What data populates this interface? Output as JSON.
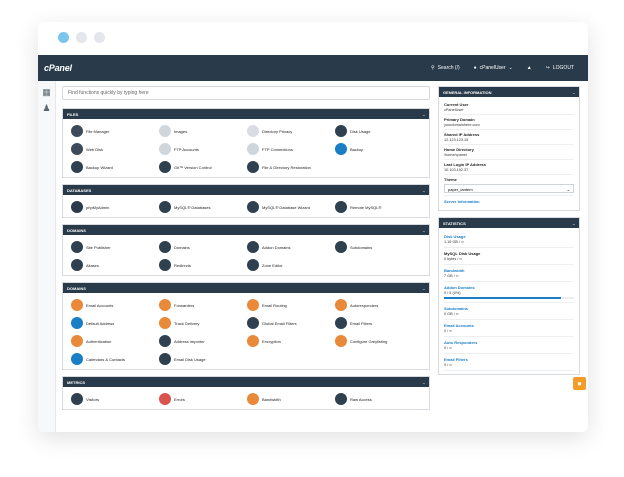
{
  "topbar": {
    "logo": "cPanel",
    "search": "Search (/)",
    "user": "cPanelUser",
    "logout": "LOGOUT"
  },
  "search": {
    "placeholder": "Find functions quickly by typing here"
  },
  "panels": [
    {
      "title": "FILES",
      "items": [
        {
          "label": "File Manager",
          "icon": "folder-icon",
          "color": "#3b4b5a"
        },
        {
          "label": "Images",
          "icon": "images-icon",
          "color": "#cfd6dc"
        },
        {
          "label": "Directory Privacy",
          "icon": "folder-lock-icon",
          "color": "#d9dde1"
        },
        {
          "label": "Disk Usage",
          "icon": "disk-icon",
          "color": "#2f4050"
        },
        {
          "label": "Web Disk",
          "icon": "webdisk-icon",
          "color": "#3b4b5a"
        },
        {
          "label": "FTP Accounts",
          "icon": "ftp-icon",
          "color": "#cfd6dc"
        },
        {
          "label": "FTP Connections",
          "icon": "truck-icon",
          "color": "#cfd6dc"
        },
        {
          "label": "Backup",
          "icon": "backup-icon",
          "color": "#1a7ec6"
        },
        {
          "label": "Backup Wizard",
          "icon": "wizard-icon",
          "color": "#2f4050"
        },
        {
          "label": "Git™ Version Control",
          "icon": "git-icon",
          "color": "#2f4050"
        },
        {
          "label": "File & Directory Restoration",
          "icon": "restore-icon",
          "color": "#2f4050"
        }
      ]
    },
    {
      "title": "DATABASES",
      "items": [
        {
          "label": "phpMyAdmin",
          "icon": "phpmyadmin-icon",
          "color": "#2a3a4a"
        },
        {
          "label": "MySQL® Databases",
          "icon": "mysql-icon",
          "color": "#2f4050"
        },
        {
          "label": "MySQL® Database Wizard",
          "icon": "mysql-wizard-icon",
          "color": "#2f4050"
        },
        {
          "label": "Remote MySQL®",
          "icon": "remote-mysql-icon",
          "color": "#2f4050"
        }
      ]
    },
    {
      "title": "DOMAINS",
      "items": [
        {
          "label": "Site Publisher",
          "icon": "publisher-icon",
          "color": "#2f4050"
        },
        {
          "label": "Domains",
          "icon": "domains-icon",
          "color": "#2f4050"
        },
        {
          "label": "Addon Domains",
          "icon": "addon-icon",
          "color": "#2f4050"
        },
        {
          "label": "Subdomains",
          "icon": "subdomain-icon",
          "color": "#2f4050"
        },
        {
          "label": "Aliases",
          "icon": "aliases-icon",
          "color": "#2f4050"
        },
        {
          "label": "Redirects",
          "icon": "redirect-icon",
          "color": "#2f4050"
        },
        {
          "label": "Zone Editor",
          "icon": "dns-icon",
          "color": "#2f4050"
        }
      ]
    },
    {
      "title": "DOMAINS",
      "items": [
        {
          "label": "Email Accounts",
          "icon": "email-icon",
          "color": "#e88a3a"
        },
        {
          "label": "Forwarders",
          "icon": "forward-icon",
          "color": "#e88a3a"
        },
        {
          "label": "Email Routing",
          "icon": "routing-icon",
          "color": "#e88a3a"
        },
        {
          "label": "Autoresponders",
          "icon": "autoresponder-icon",
          "color": "#e88a3a"
        },
        {
          "label": "Default Address",
          "icon": "default-address-icon",
          "color": "#1a7ec6"
        },
        {
          "label": "Track Delivery",
          "icon": "track-icon",
          "color": "#e88a3a"
        },
        {
          "label": "Global Email Filters",
          "icon": "filter-icon",
          "color": "#2f4050"
        },
        {
          "label": "Email Filters",
          "icon": "filter-icon",
          "color": "#2f4050"
        },
        {
          "label": "Authentication",
          "icon": "key-icon",
          "color": "#e88a3a"
        },
        {
          "label": "Address Importer",
          "icon": "import-icon",
          "color": "#2f4050"
        },
        {
          "label": "Encryption",
          "icon": "lock-icon",
          "color": "#e88a3a"
        },
        {
          "label": "Configure Greylisting",
          "icon": "greylisting-icon",
          "color": "#e88a3a"
        },
        {
          "label": "Calendars & Contacts",
          "icon": "calendar-icon",
          "color": "#1a7ec6"
        },
        {
          "label": "Email Disk Usage",
          "icon": "disk-icon",
          "color": "#2f4050"
        }
      ]
    },
    {
      "title": "METRICS",
      "items": [
        {
          "label": "Visitors",
          "icon": "visitors-icon",
          "color": "#2f4050"
        },
        {
          "label": "Errors",
          "icon": "errors-icon",
          "color": "#d9534f"
        },
        {
          "label": "Bandwidth",
          "icon": "bandwidth-icon",
          "color": "#e88a3a"
        },
        {
          "label": "Raw Access",
          "icon": "raw-icon",
          "color": "#2f4050"
        }
      ]
    }
  ],
  "general": {
    "title": "GENERAL INFORMATION",
    "rows": [
      {
        "k": "Current User",
        "v": "cPanelUser"
      },
      {
        "k": "Primary Domain",
        "v": "yourdomainhere.com"
      },
      {
        "k": "Shared IP Address",
        "v": "12.123.123.15"
      },
      {
        "k": "Home Directory",
        "v": "/home/cpanel"
      },
      {
        "k": "Last Login IP Address",
        "v": "10.103.192.37"
      }
    ],
    "theme_label": "Theme",
    "theme_value": "paper_lantern",
    "server_info": "Server Information"
  },
  "stats": {
    "title": "STATISTICS",
    "rows": [
      {
        "k": "Disk Usage",
        "v": "1.16 GB / ∞",
        "link": true
      },
      {
        "k": "MySQL Disk Usage",
        "v": "0 bytes / ∞",
        "link": false
      },
      {
        "k": "Bandwidth",
        "v": "7 GB / ∞",
        "link": true
      },
      {
        "k": "Addon Domains",
        "v": "0 / 5 (0%)",
        "link": true,
        "progress": 0.9
      },
      {
        "k": "Subdomains",
        "v": "0 GB / ∞",
        "link": true
      },
      {
        "k": "Email Accounts",
        "v": "0 / ∞",
        "link": true
      },
      {
        "k": "Auto Responders",
        "v": "0 / ∞",
        "link": true
      },
      {
        "k": "Email Filters",
        "v": "0 / ∞",
        "link": true
      }
    ]
  }
}
